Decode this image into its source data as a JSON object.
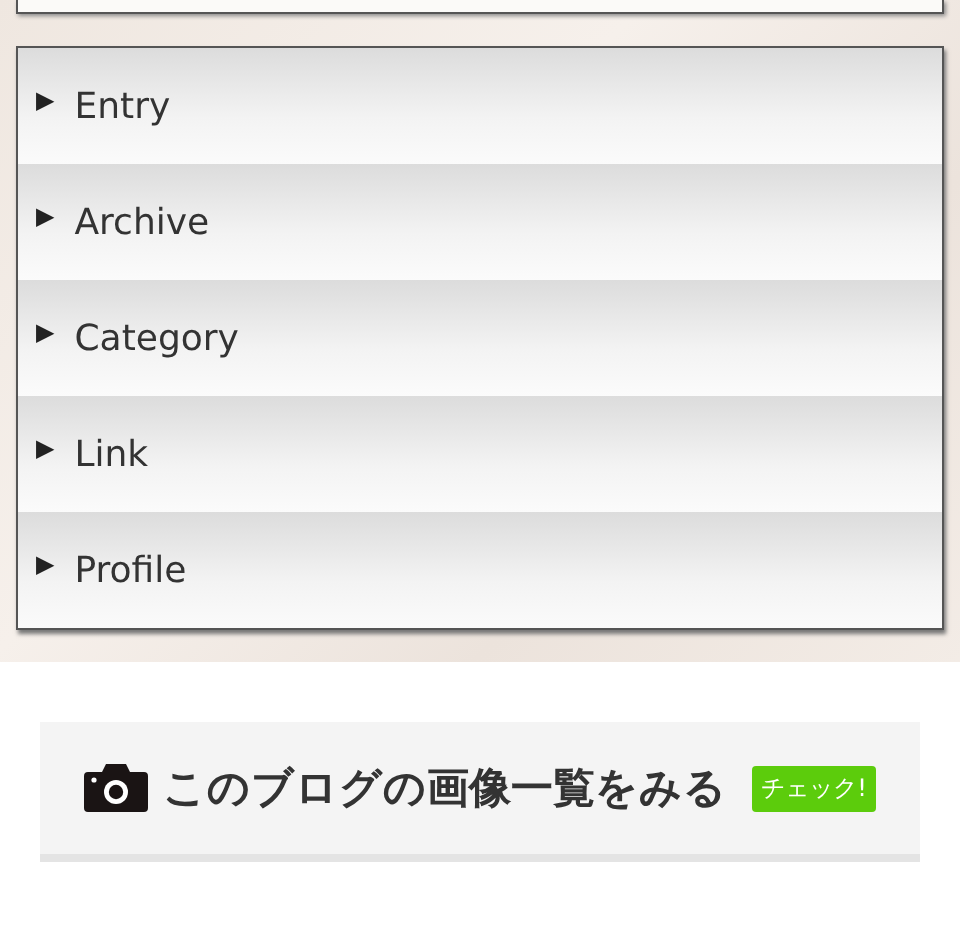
{
  "menu": {
    "items": [
      {
        "icon": "▶",
        "label": "Entry"
      },
      {
        "icon": "▶",
        "label": "Archive"
      },
      {
        "icon": "▶",
        "label": "Category"
      },
      {
        "icon": "▶",
        "label": "Link"
      },
      {
        "icon": "▶",
        "label": "Profile"
      }
    ]
  },
  "banner": {
    "label": "このブログの画像一覧をみる",
    "badge": "チェック!"
  }
}
